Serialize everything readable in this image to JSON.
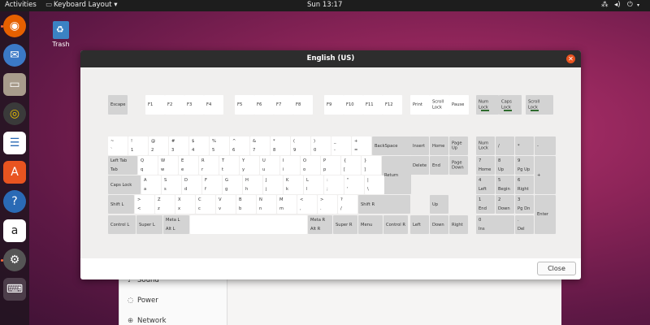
{
  "topbar": {
    "activities": "Activities",
    "app_menu": "Keyboard Layout ▾",
    "clock": "Sun 13:17"
  },
  "dock": [
    "firefox-icon",
    "thunderbird-icon",
    "files-icon",
    "rhythmbox-icon",
    "writer-icon",
    "software-icon",
    "help-icon",
    "amazon-icon",
    "settings-icon",
    "keyboard-icon"
  ],
  "desktop": {
    "trash_label": "Trash"
  },
  "settings_bg": {
    "items": [
      "Sound",
      "Power",
      "Network"
    ]
  },
  "dialog": {
    "title": "English (US)",
    "close_label": "Close"
  },
  "rows": {
    "fn": [
      {
        "t": "Escape",
        "c": "g"
      },
      {
        "t": "F1",
        "c": "w"
      },
      {
        "t": "F2",
        "c": "w"
      },
      {
        "t": "F3",
        "c": "w"
      },
      {
        "t": "F4",
        "c": "w"
      },
      {
        "t": "F5",
        "c": "w"
      },
      {
        "t": "F6",
        "c": "w"
      },
      {
        "t": "F7",
        "c": "w"
      },
      {
        "t": "F8",
        "c": "w"
      },
      {
        "t": "F9",
        "c": "w"
      },
      {
        "t": "F10",
        "c": "w"
      },
      {
        "t": "F11",
        "c": "w"
      },
      {
        "t": "F12",
        "c": "w"
      },
      {
        "t": "Print",
        "c": "w"
      },
      {
        "t": "Scroll\nLock",
        "c": "w"
      },
      {
        "t": "Pause",
        "c": "w"
      },
      {
        "t": "Num\nLock",
        "c": "g"
      },
      {
        "t": "Caps\nLock",
        "c": "g"
      },
      {
        "t": "Scroll\nLock",
        "c": "g"
      }
    ],
    "num": [
      {
        "t": "~",
        "b": "`"
      },
      {
        "t": "!",
        "b": "1"
      },
      {
        "t": "@",
        "b": "2"
      },
      {
        "t": "#",
        "b": "3"
      },
      {
        "t": "$",
        "b": "4"
      },
      {
        "t": "%",
        "b": "5"
      },
      {
        "t": "^",
        "b": "6"
      },
      {
        "t": "&",
        "b": "7"
      },
      {
        "t": "*",
        "b": "8"
      },
      {
        "t": "(",
        "b": "9"
      },
      {
        "t": ")",
        "b": "0"
      },
      {
        "t": "_",
        "b": "-"
      },
      {
        "t": "+",
        "b": "="
      },
      {
        "t": "BackSpace",
        "b": ""
      }
    ],
    "qwe": [
      {
        "t": "Left Tab",
        "b": "Tab"
      },
      {
        "t": "Q",
        "b": "q"
      },
      {
        "t": "W",
        "b": "w"
      },
      {
        "t": "E",
        "b": "e"
      },
      {
        "t": "R",
        "b": "r"
      },
      {
        "t": "T",
        "b": "t"
      },
      {
        "t": "Y",
        "b": "y"
      },
      {
        "t": "U",
        "b": "u"
      },
      {
        "t": "I",
        "b": "i"
      },
      {
        "t": "O",
        "b": "o"
      },
      {
        "t": "P",
        "b": "p"
      },
      {
        "t": "{",
        "b": "["
      },
      {
        "t": "}",
        "b": "]"
      },
      {
        "t": "Return",
        "b": ""
      }
    ],
    "asd": [
      {
        "t": "Caps Lock",
        "b": ""
      },
      {
        "t": "A",
        "b": "a"
      },
      {
        "t": "S",
        "b": "s"
      },
      {
        "t": "D",
        "b": "d"
      },
      {
        "t": "F",
        "b": "f"
      },
      {
        "t": "G",
        "b": "g"
      },
      {
        "t": "H",
        "b": "h"
      },
      {
        "t": "J",
        "b": "j"
      },
      {
        "t": "K",
        "b": "k"
      },
      {
        "t": "L",
        "b": "l"
      },
      {
        "t": ":",
        "b": ";"
      },
      {
        "t": "\"",
        "b": "'"
      },
      {
        "t": "|",
        "b": "\\"
      }
    ],
    "zxc": [
      {
        "t": "Shift L",
        "b": ""
      },
      {
        "t": ">",
        "b": "<"
      },
      {
        "t": "Z",
        "b": "z"
      },
      {
        "t": "X",
        "b": "x"
      },
      {
        "t": "C",
        "b": "c"
      },
      {
        "t": "V",
        "b": "v"
      },
      {
        "t": "B",
        "b": "b"
      },
      {
        "t": "N",
        "b": "n"
      },
      {
        "t": "M",
        "b": "m"
      },
      {
        "t": "<",
        "b": ","
      },
      {
        "t": ">",
        "b": "."
      },
      {
        "t": "?",
        "b": "/"
      },
      {
        "t": "Shift R",
        "b": ""
      }
    ],
    "bottom": [
      {
        "t": "Control L",
        "b": ""
      },
      {
        "t": "Super L",
        "b": ""
      },
      {
        "t": "Meta L",
        "b": "Alt L"
      },
      {
        "t": "",
        "b": ""
      },
      {
        "t": "Meta R",
        "b": "Alt R"
      },
      {
        "t": "Super R",
        "b": ""
      },
      {
        "t": "Menu",
        "b": ""
      },
      {
        "t": "Control R",
        "b": ""
      }
    ],
    "nav": [
      {
        "t": "Insert"
      },
      {
        "t": "Home"
      },
      {
        "t": "Page\nUp"
      },
      {
        "t": "Delete"
      },
      {
        "t": "End"
      },
      {
        "t": "Page\nDown"
      },
      {
        "t": "Up"
      },
      {
        "t": "Left"
      },
      {
        "t": "Down"
      },
      {
        "t": "Right"
      }
    ],
    "pad": [
      {
        "t": "Num\nLock",
        "b": ""
      },
      {
        "t": "/",
        "b": ""
      },
      {
        "t": "*",
        "b": ""
      },
      {
        "t": "-",
        "b": ""
      },
      {
        "t": "7",
        "b": "Home"
      },
      {
        "t": "8",
        "b": "Up"
      },
      {
        "t": "9",
        "b": "Pg Up"
      },
      {
        "t": "+",
        "b": ""
      },
      {
        "t": "4",
        "b": "Left"
      },
      {
        "t": "5",
        "b": "Begin"
      },
      {
        "t": "6",
        "b": "Right"
      },
      {
        "t": "1",
        "b": "End"
      },
      {
        "t": "2",
        "b": "Down"
      },
      {
        "t": "3",
        "b": "Pg Dn"
      },
      {
        "t": "Enter",
        "b": ""
      },
      {
        "t": "0",
        "b": "Ins"
      },
      {
        "t": ".",
        "b": "Del"
      }
    ]
  }
}
